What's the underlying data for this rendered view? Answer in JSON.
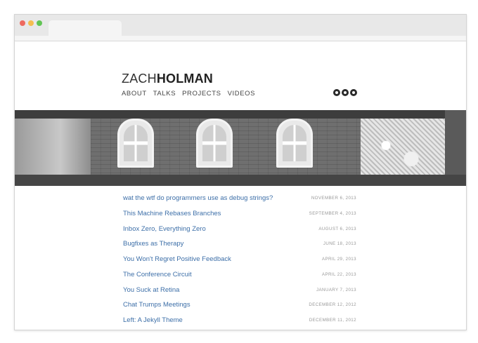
{
  "site": {
    "logo_light": "ZACH",
    "logo_bold": "HOLMAN",
    "nav": [
      "ABOUT",
      "TALKS",
      "PROJECTS",
      "VIDEOS"
    ],
    "social_icons": [
      "github-icon",
      "twitter-icon",
      "rss-icon"
    ]
  },
  "posts": [
    {
      "title": "wat the wtf do programmers use as debug strings?",
      "date": "NOVEMBER 6, 2013"
    },
    {
      "title": "This Machine Rebases Branches",
      "date": "SEPTEMBER 4, 2013"
    },
    {
      "title": "Inbox Zero, Everything Zero",
      "date": "AUGUST 6, 2013"
    },
    {
      "title": "Bugfixes as Therapy",
      "date": "JUNE 18, 2013"
    },
    {
      "title": "You Won't Regret Positive Feedback",
      "date": "APRIL 29, 2013"
    },
    {
      "title": "The Conference Circuit",
      "date": "APRIL 22, 2013"
    },
    {
      "title": "You Suck at Retina",
      "date": "JANUARY 7, 2013"
    },
    {
      "title": "Chat Trumps Meetings",
      "date": "DECEMBER 12, 2012"
    },
    {
      "title": "Left: A Jekyll Theme",
      "date": "DECEMBER 11, 2012"
    }
  ],
  "colors": {
    "link": "#3d6fa8",
    "date": "#999999",
    "chrome": "#e8e8e8"
  }
}
